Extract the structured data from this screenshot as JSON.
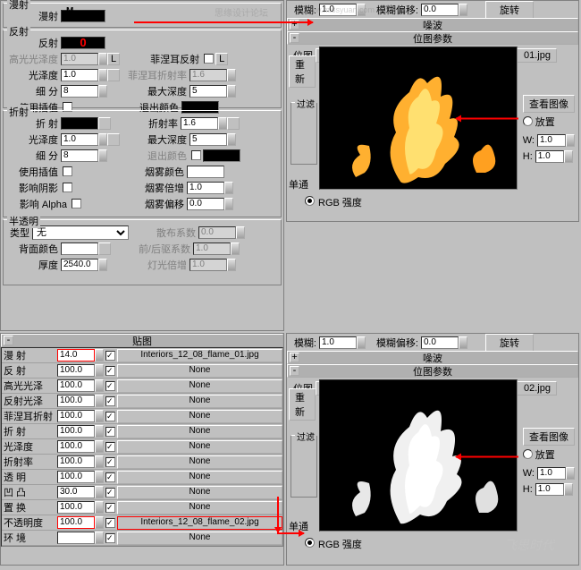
{
  "watermark_top": "思缘设计论坛",
  "watermark_url": "www.missyuan.com",
  "watermark_bottom": "飞思时代",
  "top_left": {
    "diffuse": {
      "grp": "漫射",
      "lbl": "漫射",
      "m": "M"
    },
    "reflect": {
      "grp": "反射",
      "lbl": "反射",
      "rows": [
        {
          "l": "高光光泽度",
          "v": "1.0",
          "gray": true,
          "chk": "L",
          "r_l": "菲涅耳反射",
          "r_chk": true,
          "r_L": "L"
        },
        {
          "l": "光泽度",
          "v": "1.0",
          "chk": true,
          "r_l": "菲涅耳折射率",
          "r_v": "1.6",
          "r_gray": true
        },
        {
          "l": "细  分",
          "v": "8",
          "r_l": "最大深度",
          "r_v": "5"
        },
        {
          "l": "使用插值",
          "chk": false,
          "r_l": "退出颜色",
          "r_swatch": true
        }
      ]
    },
    "refract": {
      "grp": "折射",
      "lbl": "折射",
      "rows": [
        {
          "l": "折  射",
          "swatch": true,
          "r_l": "折射率",
          "r_v": "1.6"
        },
        {
          "l": "光泽度",
          "v": "1.0",
          "r_l": "最大深度",
          "r_v": "5"
        },
        {
          "l": "细  分",
          "v": "8",
          "r_l": "退出颜色",
          "r_gray": true,
          "r_swatch": true,
          "r_chk": true
        },
        {
          "l": "使用插值",
          "chk": false,
          "r_l": "烟雾颜色",
          "r_swatch_w": true
        },
        {
          "l": "影响阴影",
          "chk": false,
          "r_l": "烟雾倍增",
          "r_v": "1.0"
        },
        {
          "l": "影响 Alpha",
          "chk": false,
          "r_l": "烟雾偏移",
          "r_v": "0.0"
        }
      ]
    },
    "trans": {
      "grp": "半透明",
      "type_l": "类型",
      "type_v": "无",
      "rows": [
        {
          "l": "背面颜色",
          "swatch_w": true,
          "r_l": "散布系数",
          "r_v": "0.0",
          "r_gray": true
        },
        {
          "l": "",
          "r_l": "前/后驱系数",
          "r_v": "1.0",
          "r_gray": true
        },
        {
          "l": "厚度",
          "v": "2540.0",
          "r_l": "灯光倍增",
          "r_v": "1.0",
          "r_gray": true
        }
      ]
    }
  },
  "top_right": {
    "blur_l": "模糊:",
    "blur_v": "1.0",
    "blur_off_l": "模糊偏移:",
    "blur_off_v": "0.0",
    "rotate": "旋转",
    "noise_hdr": "噪波",
    "bitmap_hdr": "位图参数",
    "bitmap_l": "位图",
    "bitmap_v": "01.jpg",
    "reload_l": "重新",
    "filter_grp": "过滤",
    "view_btn": "查看图像",
    "place_l": "放置",
    "w_l": "W:",
    "w_v": "1.0",
    "h_l": "H:",
    "h_v": "1.0",
    "single_l": "单通",
    "rgb_l": "RGB 强度"
  },
  "maps": {
    "hdr": "贴图",
    "rows": [
      {
        "n": "漫  射",
        "v": "14.0",
        "red": true,
        "on": true,
        "slot": "Interiors_12_08_flame_01.jpg"
      },
      {
        "n": "反  射",
        "v": "100.0",
        "on": true,
        "slot": "None"
      },
      {
        "n": "高光光泽",
        "v": "100.0",
        "on": true,
        "slot": "None"
      },
      {
        "n": "反射光泽",
        "v": "100.0",
        "on": true,
        "slot": "None"
      },
      {
        "n": "菲涅耳折射",
        "v": "100.0",
        "on": true,
        "slot": "None"
      },
      {
        "n": "折  射",
        "v": "100.0",
        "on": true,
        "slot": "None"
      },
      {
        "n": "光泽度",
        "v": "100.0",
        "on": true,
        "slot": "None"
      },
      {
        "n": "折射率",
        "v": "100.0",
        "on": true,
        "slot": "None"
      },
      {
        "n": "透  明",
        "v": "100.0",
        "on": true,
        "slot": "None"
      },
      {
        "n": "凹  凸",
        "v": "30.0",
        "on": true,
        "slot": "None"
      },
      {
        "n": "置  换",
        "v": "100.0",
        "on": true,
        "slot": "None"
      },
      {
        "n": "不透明度",
        "v": "100.0",
        "red": true,
        "on": true,
        "slot": "Interiors_12_08_flame_02.jpg",
        "slot_red": true
      },
      {
        "n": "环  境",
        "v": "",
        "on": true,
        "slot": "None"
      }
    ]
  },
  "bot_right": {
    "blur_l": "模糊:",
    "blur_v": "1.0",
    "blur_off_l": "模糊偏移:",
    "blur_off_v": "0.0",
    "rotate": "旋转",
    "noise_hdr": "噪波",
    "bitmap_hdr": "位图参数",
    "bitmap_l": "位图",
    "bitmap_v": "02.jpg",
    "reload_l": "重新",
    "filter_grp": "过滤",
    "view_btn": "查看图像",
    "place_l": "放置",
    "w_l": "W:",
    "w_v": "1.0",
    "h_l": "H:",
    "h_v": "1.0",
    "single_l": "单通",
    "rgb_l": "RGB 强度"
  }
}
